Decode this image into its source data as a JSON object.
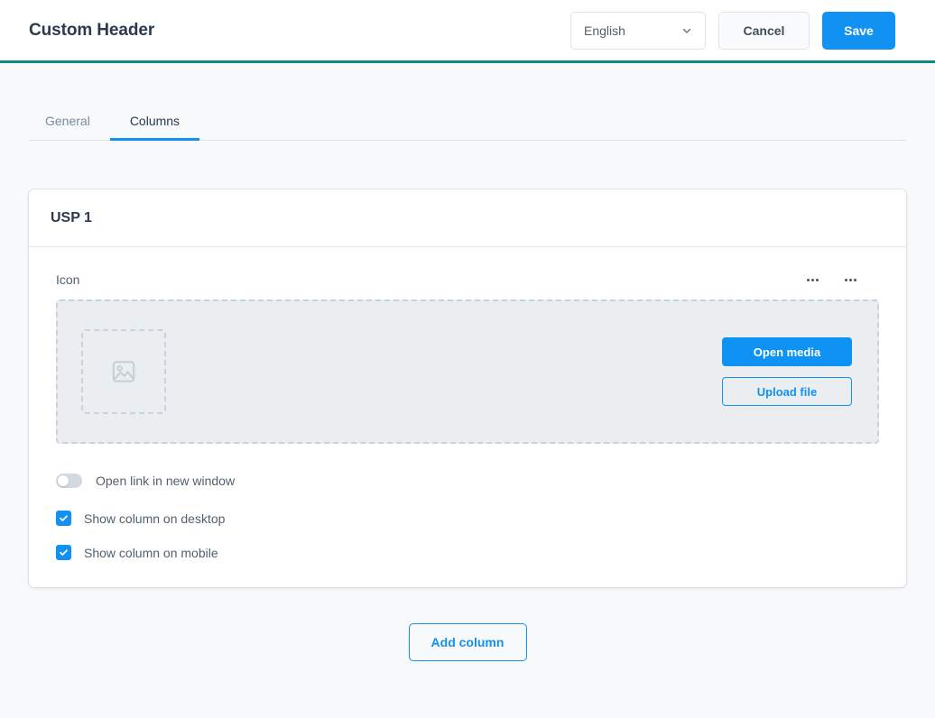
{
  "header": {
    "title": "Custom Header",
    "language_value": "English",
    "language_options": [
      "English"
    ],
    "cancel_label": "Cancel",
    "save_label": "Save",
    "accent_bar_color": "#0d8a86"
  },
  "tabs": [
    {
      "label": "General",
      "active": false
    },
    {
      "label": "Columns",
      "active": true
    }
  ],
  "card": {
    "title": "USP 1",
    "icon_field": {
      "label": "Icon",
      "open_media_label": "Open media",
      "upload_file_label": "Upload file"
    },
    "options": {
      "open_link_new_window": {
        "label": "Open link in new window",
        "checked": false
      },
      "show_on_desktop": {
        "label": "Show column on desktop",
        "checked": true
      },
      "show_on_mobile": {
        "label": "Show column on mobile",
        "checked": true
      }
    }
  },
  "footer": {
    "add_column_label": "Add column"
  },
  "colors": {
    "primary": "#1191f2",
    "accent_teal": "#0d8a86",
    "page_bg": "#f7f9fb",
    "text_dark": "#2b3a4d",
    "text_muted": "#7a8a99"
  }
}
